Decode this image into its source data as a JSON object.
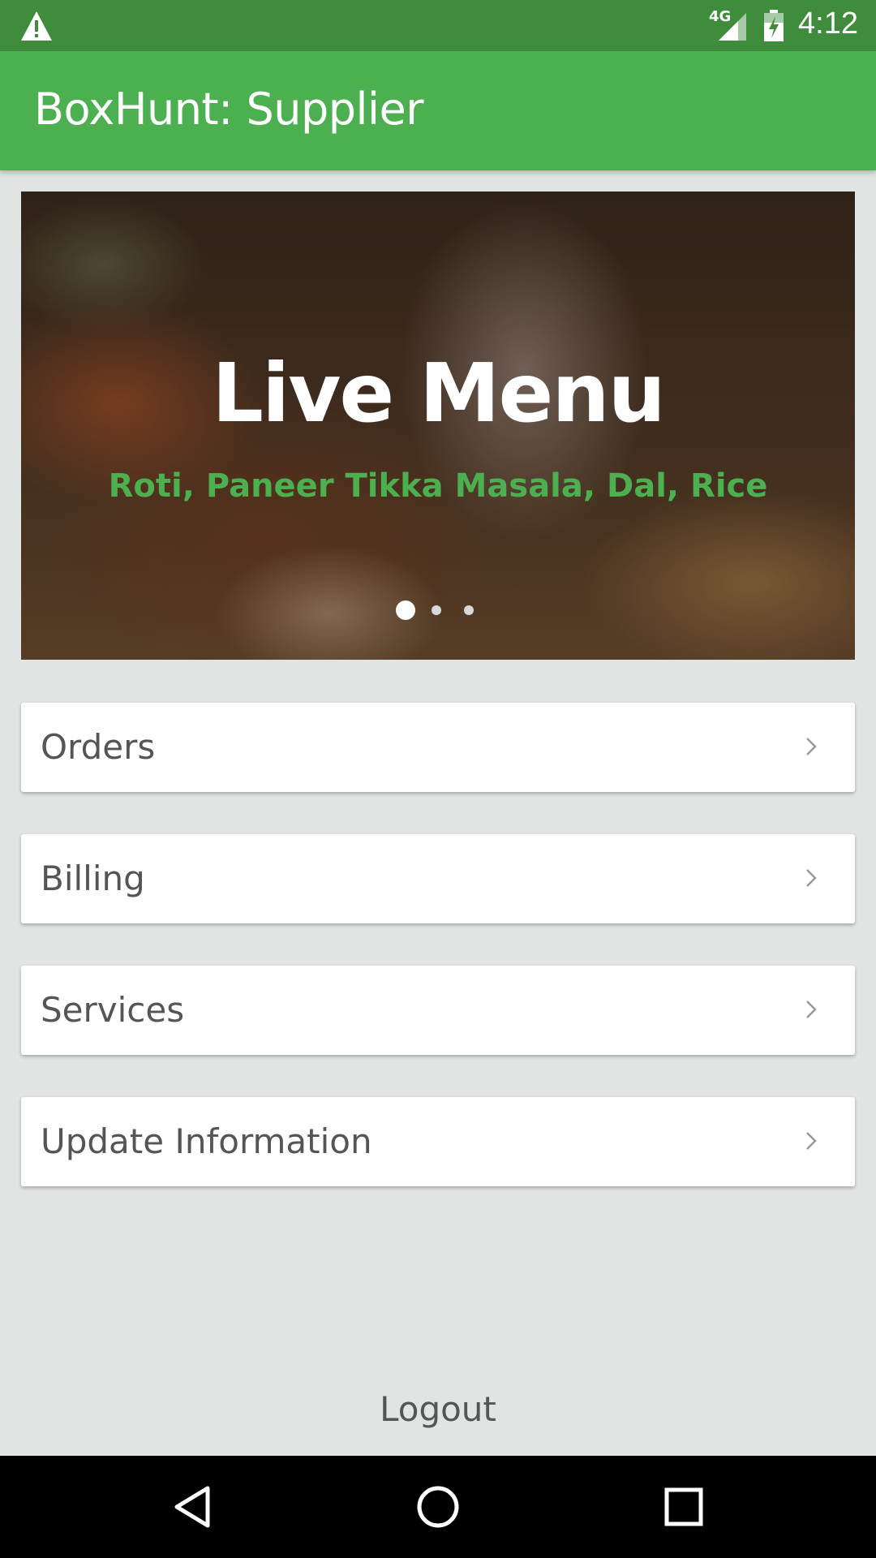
{
  "status_bar": {
    "alert_icon": "warning-triangle-icon",
    "network": "4G",
    "time": "4:12"
  },
  "app_bar": {
    "title": "BoxHunt: Supplier"
  },
  "banner": {
    "title": "Live Menu",
    "subtitle": "Roti, Paneer Tikka Masala, Dal, Rice",
    "page_count": 3,
    "active_page": 1
  },
  "menu": {
    "items": [
      {
        "label": "Orders"
      },
      {
        "label": "Billing"
      },
      {
        "label": "Services"
      },
      {
        "label": "Update Information"
      }
    ]
  },
  "footer": {
    "logout_label": "Logout"
  },
  "nav": {
    "back": "back-triangle-icon",
    "home": "home-circle-icon",
    "recents": "recents-square-icon"
  },
  "colors": {
    "status_bar": "#3f8c3c",
    "app_bar": "#4caf50",
    "accent_text": "#4caf50",
    "background": "#e0e4e3"
  }
}
